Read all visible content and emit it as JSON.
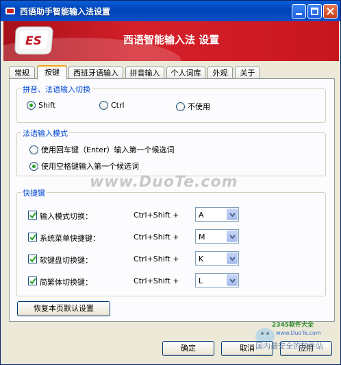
{
  "window": {
    "title": "西语助手智能输入法设置",
    "banner_title": "西语智能输入法 设置",
    "logo_text": "ES"
  },
  "tabs": [
    {
      "label": "常规",
      "active": false
    },
    {
      "label": "按键",
      "active": true
    },
    {
      "label": "西班牙语输入",
      "active": false
    },
    {
      "label": "拼音输入",
      "active": false
    },
    {
      "label": "个人词库",
      "active": false
    },
    {
      "label": "外观",
      "active": false
    },
    {
      "label": "关于",
      "active": false
    }
  ],
  "pinyin_switch": {
    "title": "拼音、法语输入切换",
    "options": [
      {
        "label": "Shift",
        "selected": true
      },
      {
        "label": "Ctrl",
        "selected": false
      },
      {
        "label": "不使用",
        "selected": false
      }
    ]
  },
  "input_mode": {
    "title": "法语输入模式",
    "options": [
      {
        "label": "使用回车键（Enter）输入第一个候选词",
        "selected": false
      },
      {
        "label": "使用空格键输入第一个候选词",
        "selected": true
      }
    ]
  },
  "hotkeys": {
    "title": "快捷键",
    "rows": [
      {
        "label": "输入模式切换：",
        "checked": true,
        "combo": "Ctrl+Shift +",
        "key": "A"
      },
      {
        "label": "系统菜单快捷键：",
        "checked": true,
        "combo": "Ctrl+Shift +",
        "key": "M"
      },
      {
        "label": "软键盘切换键：",
        "checked": true,
        "combo": "Ctrl+Shift +",
        "key": "K"
      },
      {
        "label": "简繁体切换键：",
        "checked": true,
        "combo": "Ctrl+Shift +",
        "key": "L"
      }
    ]
  },
  "restore_button": "恢复本页默认设置",
  "buttons": {
    "ok": "确定",
    "cancel": "取消",
    "apply": "应用"
  },
  "watermarks": {
    "center": "www.DuoTe.com",
    "corner_brand": "2345软件大全",
    "corner_url": "www.DuoTe.com",
    "corner_slogan": "国内最安全的软件站"
  }
}
